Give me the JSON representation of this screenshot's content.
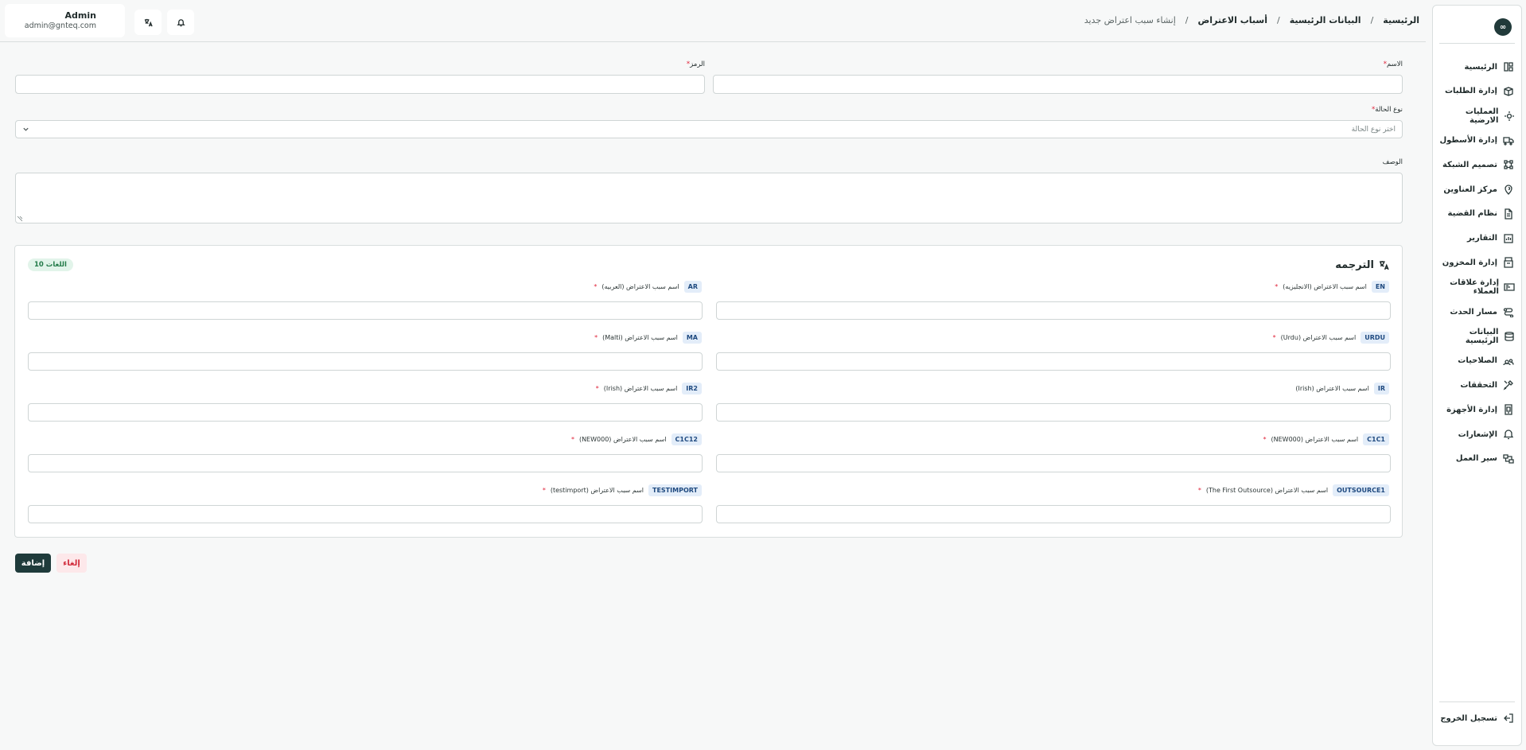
{
  "user": {
    "name": "Admin",
    "email": "admin@gnteq.com"
  },
  "header": {
    "breadcrumb": [
      "الرئيسية",
      "البيانات الرئيسية",
      "أسباب الاعتراض",
      "إنشاء سبب اعتراض جديد"
    ],
    "separator": "/"
  },
  "sidebar": {
    "logo": "∞",
    "items": [
      {
        "label": "الرئيسية",
        "icon": "layout-icon"
      },
      {
        "label": "إدارة الطلبات",
        "icon": "package-icon"
      },
      {
        "label": "العمليات الارضية",
        "icon": "settings-icon"
      },
      {
        "label": "إدارة الأسطول",
        "icon": "truck-icon"
      },
      {
        "label": "تصميم الشبكة",
        "icon": "network-icon"
      },
      {
        "label": "مركز العناوين",
        "icon": "map-pin-icon"
      },
      {
        "label": "نظام القضية",
        "icon": "file-icon"
      },
      {
        "label": "التقارير",
        "icon": "report-icon"
      },
      {
        "label": "إدارة المخزون",
        "icon": "box-icon"
      },
      {
        "label": "إدارة علاقات العملاء",
        "icon": "crm-icon"
      },
      {
        "label": "مسار الحدث",
        "icon": "route-icon"
      },
      {
        "label": "البيانات الرئيسية",
        "icon": "database-icon"
      },
      {
        "label": "الصلاحيات",
        "icon": "users-icon"
      },
      {
        "label": "التحققات",
        "icon": "tools-icon"
      },
      {
        "label": "إدارة الأجهزة",
        "icon": "device-icon"
      },
      {
        "label": "الإشعارات",
        "icon": "bell-icon"
      },
      {
        "label": "سير العمل",
        "icon": "workflow-icon"
      }
    ],
    "logout": "تسجيل الخروج"
  },
  "form": {
    "name_label": "الاسم",
    "code_label": "الرمز",
    "status_label": "نوع الحالة",
    "status_placeholder": "اختر نوع الحالة",
    "description_label": "الوصف",
    "required_mark": "*"
  },
  "translation": {
    "title": "الترجمه",
    "count_badge": "10 اللغات",
    "rows": [
      [
        {
          "code": "EN",
          "label": "اسم سبب الاعتراض (الانجليزيه)",
          "required": true
        },
        {
          "code": "AR",
          "label": "اسم سبب الاعتراض (العربيه)",
          "required": true
        }
      ],
      [
        {
          "code": "URDU",
          "label": "اسم سبب الاعتراض (Urdu)",
          "required": true
        },
        {
          "code": "MA",
          "label": "اسم سبب الاعتراض (Malti)",
          "required": true
        }
      ],
      [
        {
          "code": "IR",
          "label": "اسم سبب الاعتراض (Irish)",
          "required": false
        },
        {
          "code": "IR2",
          "label": "اسم سبب الاعتراض (Irish)",
          "required": true
        }
      ],
      [
        {
          "code": "C1C1",
          "label": "اسم سبب الاعتراض (NEW000)",
          "required": true
        },
        {
          "code": "C1C12",
          "label": "اسم سبب الاعتراض (NEW000)",
          "required": true
        }
      ],
      [
        {
          "code": "OUTSOURCE1",
          "label": "اسم سبب الاعتراض (The First Outsource)",
          "required": true
        },
        {
          "code": "TESTIMPORT",
          "label": "اسم سبب الاعتراض (testimport)",
          "required": true
        }
      ]
    ]
  },
  "actions": {
    "add": "إضافة",
    "cancel": "إلغاء"
  },
  "colors": {
    "primary": "#1f3b3b",
    "danger": "#d12a3a",
    "badge_green": "#227a48",
    "code_badge": "#1f4a80"
  }
}
